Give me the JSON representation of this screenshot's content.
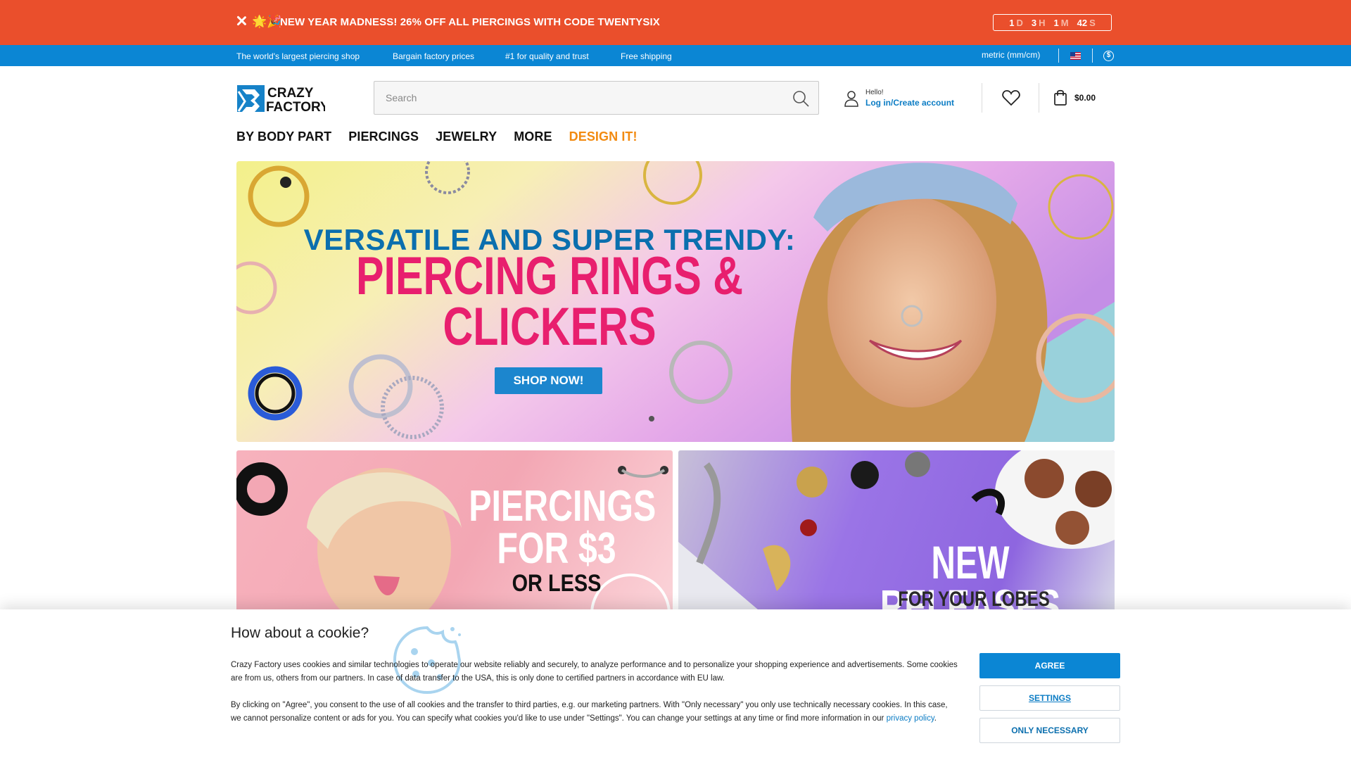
{
  "promo": {
    "emoji": "🌟🎉",
    "text": "NEW YEAR MADNESS! 26% OFF ALL PIERCINGS WITH CODE TWENTYSIX",
    "countdown": [
      {
        "value": "1",
        "unit": "D"
      },
      {
        "value": "3",
        "unit": "H"
      },
      {
        "value": "1",
        "unit": "M"
      },
      {
        "value": "42",
        "unit": "S"
      }
    ]
  },
  "infobar": {
    "usps": [
      "The world's largest piercing shop",
      "Bargain factory prices",
      "#1 for quality and trust",
      "Free shipping"
    ],
    "units": "metric (mm/cm)",
    "currency_symbol": "$"
  },
  "header": {
    "logo_line1": "CRAZY",
    "logo_line2": "FACTORY",
    "search_placeholder": "Search",
    "hello": "Hello!",
    "login": "Log in/Create account",
    "cart_total": "$0.00"
  },
  "nav": {
    "items": [
      "BY BODY PART",
      "PIERCINGS",
      "JEWELRY",
      "MORE"
    ],
    "accent_item": "DESIGN IT!"
  },
  "hero": {
    "line1": "VERSATILE AND SUPER TRENDY:",
    "line2a": "PIERCING RINGS &",
    "line2b": "CLICKERS",
    "cta": "SHOP NOW!"
  },
  "tiles": {
    "left": {
      "line1": "PIERCINGS",
      "line2": "FOR $3",
      "line3": "OR LESS"
    },
    "right": {
      "line1": "NEW RELEASES",
      "line2": "FOR YOUR LOBES"
    }
  },
  "cookie": {
    "title": "How about a cookie?",
    "p1": "Crazy Factory uses cookies and similar technologies to operate our website reliably and securely, to analyze performance and to personalize your shopping experience and advertisements. Some cookies are from us, others from our partners. In case of data transfer to the USA, this is only done to certified partners in accordance with EU law.",
    "p2": "By clicking on \"Agree\", you consent to the use of all cookies and the transfer to third parties, e.g. our marketing partners. With \"Only necessary\" you only use technically necessary cookies. In this case, we cannot personalize content or ads for you. You can specify what cookies you'd like to use under \"Settings\". You can change your settings at any time or find more information in our",
    "privacy_link": "privacy policy",
    "agree": "AGREE",
    "settings": "SETTINGS",
    "only_necessary": "ONLY NECESSARY"
  },
  "colors": {
    "promo_bg": "#ea4f2c",
    "infobar_bg": "#0b86d4",
    "accent_orange": "#f28a10",
    "link_blue": "#0b7cc4",
    "hero_pink": "#e81f6e"
  }
}
